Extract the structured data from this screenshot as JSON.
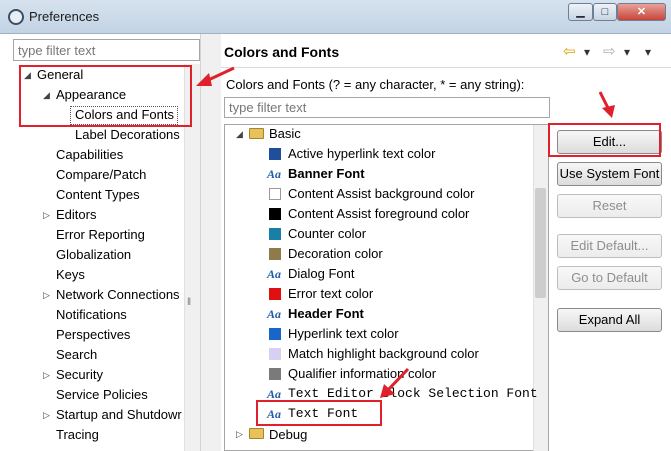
{
  "window": {
    "title": "Preferences",
    "min": "▁",
    "max": "□",
    "close": "✕"
  },
  "left": {
    "filter_placeholder": "type filter text",
    "tree": [
      {
        "label": "General",
        "arrow": "◢"
      },
      {
        "label": "Appearance",
        "arrow": "◢"
      },
      {
        "label": "Colors and Fonts",
        "selected": true
      },
      {
        "label": "Label Decorations"
      },
      {
        "label": "Capabilities"
      },
      {
        "label": "Compare/Patch"
      },
      {
        "label": "Content Types"
      },
      {
        "label": "Editors",
        "arrow": "▷"
      },
      {
        "label": "Error Reporting"
      },
      {
        "label": "Globalization"
      },
      {
        "label": "Keys"
      },
      {
        "label": "Network Connections",
        "arrow": "▷"
      },
      {
        "label": "Notifications"
      },
      {
        "label": "Perspectives"
      },
      {
        "label": "Search"
      },
      {
        "label": "Security",
        "arrow": "▷"
      },
      {
        "label": "Service Policies"
      },
      {
        "label": "Startup and Shutdowr",
        "arrow": "▷"
      },
      {
        "label": "Tracing"
      }
    ]
  },
  "right": {
    "page_title": "Colors and Fonts",
    "description": "Colors and Fonts (? = any character, * = any string):",
    "filter_placeholder": "type filter text",
    "categories": [
      {
        "label": "Basic",
        "arrow": "◢"
      },
      {
        "label": "Debug",
        "arrow": "▷"
      }
    ],
    "items": [
      {
        "label": "Active hyperlink text color",
        "kind": "color",
        "color": "#1f4e9c"
      },
      {
        "label": "Banner Font",
        "kind": "font",
        "bold": true
      },
      {
        "label": "Content Assist background color",
        "kind": "color",
        "color": "#ffffff"
      },
      {
        "label": "Content Assist foreground color",
        "kind": "color",
        "color": "#000000"
      },
      {
        "label": "Counter color",
        "kind": "color",
        "color": "#1a7fa6"
      },
      {
        "label": "Decoration color",
        "kind": "color",
        "color": "#8e7a4a"
      },
      {
        "label": "Dialog Font",
        "kind": "font"
      },
      {
        "label": "Error text color",
        "kind": "color",
        "color": "#e01010"
      },
      {
        "label": "Header Font",
        "kind": "font",
        "bold": true
      },
      {
        "label": "Hyperlink text color",
        "kind": "color",
        "color": "#1766c8"
      },
      {
        "label": "Match highlight background color",
        "kind": "color",
        "color": "#d8d0f4"
      },
      {
        "label": "Qualifier information color",
        "kind": "color",
        "color": "#7a7a7a"
      },
      {
        "label": "Text Editor Block Selection Font",
        "kind": "font",
        "mono": true
      },
      {
        "label": "Text Font",
        "kind": "font",
        "mono": true
      }
    ],
    "font_icon": "Aa",
    "buttons": {
      "edit": "Edit...",
      "use_system_font": "Use System Font",
      "reset": "Reset",
      "edit_default": "Edit Default...",
      "go_to_default": "Go to Default",
      "expand_all": "Expand All"
    },
    "nav": {
      "back": "⇦",
      "forward": "⇨",
      "dropdown": "▾",
      "menu": "▾"
    }
  },
  "colors": {
    "annotation": "#e0202a",
    "folder": "#e7c25c"
  }
}
